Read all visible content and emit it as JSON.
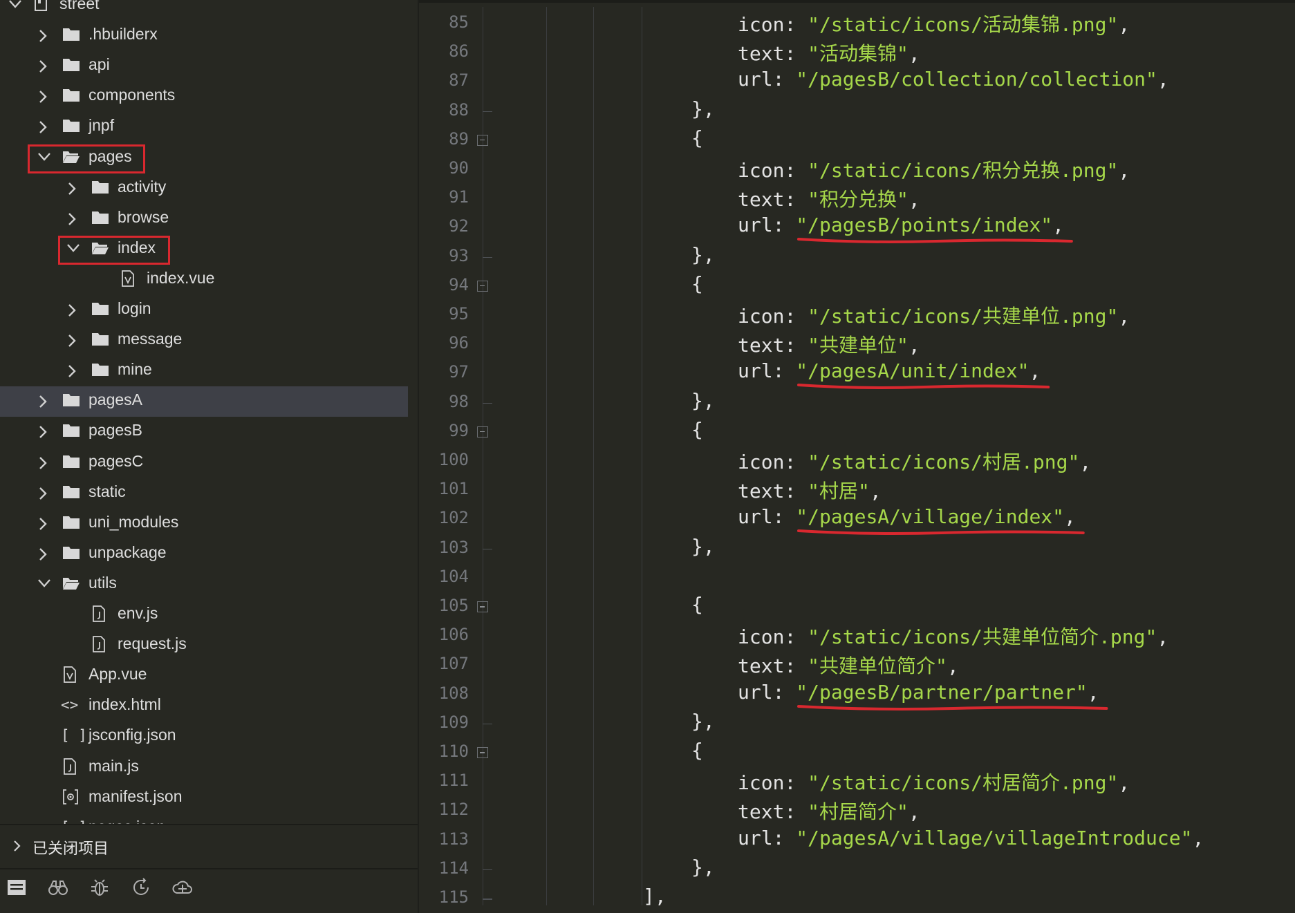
{
  "explorer": {
    "root": "street",
    "items": [
      {
        "label": ".hbuilderx",
        "kind": "folder",
        "open": false,
        "depth": 1
      },
      {
        "label": "api",
        "kind": "folder",
        "open": false,
        "depth": 1
      },
      {
        "label": "components",
        "kind": "folder",
        "open": false,
        "depth": 1
      },
      {
        "label": "jnpf",
        "kind": "folder",
        "open": false,
        "depth": 1
      },
      {
        "label": "pages",
        "kind": "folder",
        "open": true,
        "depth": 1
      },
      {
        "label": "activity",
        "kind": "folder",
        "open": false,
        "depth": 2
      },
      {
        "label": "browse",
        "kind": "folder",
        "open": false,
        "depth": 2
      },
      {
        "label": "index",
        "kind": "folder",
        "open": true,
        "depth": 2
      },
      {
        "label": "index.vue",
        "kind": "vue",
        "depth": 3
      },
      {
        "label": "login",
        "kind": "folder",
        "open": false,
        "depth": 2
      },
      {
        "label": "message",
        "kind": "folder",
        "open": false,
        "depth": 2
      },
      {
        "label": "mine",
        "kind": "folder",
        "open": false,
        "depth": 2
      },
      {
        "label": "pagesA",
        "kind": "folder",
        "open": false,
        "depth": 1,
        "selected": true
      },
      {
        "label": "pagesB",
        "kind": "folder",
        "open": false,
        "depth": 1
      },
      {
        "label": "pagesC",
        "kind": "folder",
        "open": false,
        "depth": 1
      },
      {
        "label": "static",
        "kind": "folder",
        "open": false,
        "depth": 1
      },
      {
        "label": "uni_modules",
        "kind": "folder",
        "open": false,
        "depth": 1
      },
      {
        "label": "unpackage",
        "kind": "folder",
        "open": false,
        "depth": 1
      },
      {
        "label": "utils",
        "kind": "folder",
        "open": true,
        "depth": 1
      },
      {
        "label": "env.js",
        "kind": "js",
        "depth": 2
      },
      {
        "label": "request.js",
        "kind": "js",
        "depth": 2
      },
      {
        "label": "App.vue",
        "kind": "vue",
        "depth": 1
      },
      {
        "label": "index.html",
        "kind": "html",
        "depth": 1
      },
      {
        "label": "jsconfig.json",
        "kind": "json",
        "depth": 1
      },
      {
        "label": "main.js",
        "kind": "js",
        "depth": 1
      },
      {
        "label": "manifest.json",
        "kind": "manifest",
        "depth": 1
      },
      {
        "label": "pages.json",
        "kind": "json",
        "depth": 1
      }
    ],
    "highlighted": [
      "pages",
      "index"
    ],
    "closed_projects_label": "已关闭项目"
  },
  "toolbar": [
    "project-icon",
    "binoculars-icon",
    "bug-icon",
    "history-icon",
    "cloud-icon"
  ],
  "editor": {
    "lines": [
      {
        "n": "85",
        "indent": 3,
        "key": "icon",
        "value": "\"/static/icons/活动集锦.png\"",
        "end": ","
      },
      {
        "n": "86",
        "indent": 3,
        "key": "text",
        "value": "\"活动集锦\"",
        "end": ","
      },
      {
        "n": "87",
        "indent": 3,
        "key": "url",
        "value": "\"/pagesB/collection/collection\"",
        "end": ","
      },
      {
        "n": "88",
        "indent": 2,
        "raw": "},",
        "foldend": true
      },
      {
        "n": "89",
        "indent": 2,
        "raw": "{",
        "fold": true
      },
      {
        "n": "90",
        "indent": 3,
        "key": "icon",
        "value": "\"/static/icons/积分兑换.png\"",
        "end": ","
      },
      {
        "n": "91",
        "indent": 3,
        "key": "text",
        "value": "\"积分兑换\"",
        "end": ","
      },
      {
        "n": "92",
        "indent": 3,
        "key": "url",
        "value": "\"/pagesB/points/index\"",
        "end": ",",
        "underline": true
      },
      {
        "n": "93",
        "indent": 2,
        "raw": "},",
        "foldend": true
      },
      {
        "n": "94",
        "indent": 2,
        "raw": "{",
        "fold": true
      },
      {
        "n": "95",
        "indent": 3,
        "key": "icon",
        "value": "\"/static/icons/共建单位.png\"",
        "end": ","
      },
      {
        "n": "96",
        "indent": 3,
        "key": "text",
        "value": "\"共建单位\"",
        "end": ","
      },
      {
        "n": "97",
        "indent": 3,
        "key": "url",
        "value": "\"/pagesA/unit/index\"",
        "end": ",",
        "underline": true
      },
      {
        "n": "98",
        "indent": 2,
        "raw": "},",
        "foldend": true
      },
      {
        "n": "99",
        "indent": 2,
        "raw": "{",
        "fold": true
      },
      {
        "n": "100",
        "indent": 3,
        "key": "icon",
        "value": "\"/static/icons/村居.png\"",
        "end": ","
      },
      {
        "n": "101",
        "indent": 3,
        "key": "text",
        "value": "\"村居\"",
        "end": ","
      },
      {
        "n": "102",
        "indent": 3,
        "key": "url",
        "value": "\"/pagesA/village/index\"",
        "end": ",",
        "underline": true
      },
      {
        "n": "103",
        "indent": 2,
        "raw": "},",
        "foldend": true
      },
      {
        "n": "104",
        "indent": 0,
        "raw": ""
      },
      {
        "n": "105",
        "indent": 2,
        "raw": "{",
        "fold": true
      },
      {
        "n": "106",
        "indent": 3,
        "key": "icon",
        "value": "\"/static/icons/共建单位简介.png\"",
        "end": ","
      },
      {
        "n": "107",
        "indent": 3,
        "key": "text",
        "value": "\"共建单位简介\"",
        "end": ","
      },
      {
        "n": "108",
        "indent": 3,
        "key": "url",
        "value": "\"/pagesB/partner/partner\"",
        "end": ",",
        "underline": true
      },
      {
        "n": "109",
        "indent": 2,
        "raw": "},",
        "foldend": true
      },
      {
        "n": "110",
        "indent": 2,
        "raw": "{",
        "fold": true
      },
      {
        "n": "111",
        "indent": 3,
        "key": "icon",
        "value": "\"/static/icons/村居简介.png\"",
        "end": ","
      },
      {
        "n": "112",
        "indent": 3,
        "key": "text",
        "value": "\"村居简介\"",
        "end": ","
      },
      {
        "n": "113",
        "indent": 3,
        "key": "url",
        "value": "\"/pagesA/village/villageIntroduce\"",
        "end": ","
      },
      {
        "n": "114",
        "indent": 2,
        "raw": "},",
        "foldend": true
      },
      {
        "n": "115",
        "indent": 1,
        "raw": "],",
        "foldend": true
      }
    ]
  },
  "colors": {
    "background": "#272822",
    "string": "#a6d84a",
    "line_number": "#75787d",
    "highlight": "#d9282f",
    "selected_row": "#3e4047"
  }
}
